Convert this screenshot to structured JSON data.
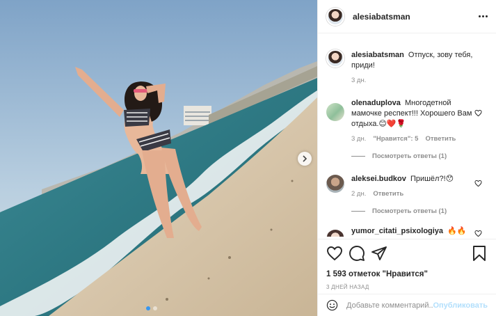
{
  "post": {
    "username": "alesiabatsman",
    "caption": "Отпуск, зову тебя, приди!",
    "caption_time": "3 дн.",
    "photo_icon": "beach-photo",
    "next_icon": "chevron-right-icon"
  },
  "comments": [
    {
      "username": "olenaduplova",
      "text": "Многодетной мамочке респект!!! Хорошего Вам отдыха.😊❤️🌹",
      "time": "3 дн.",
      "likes": "\"Нравится\": 5",
      "reply_label": "Ответить",
      "view_replies": "Посмотреть ответы (1)"
    },
    {
      "username": "aleksei.budkov",
      "text": "Пришёл?!😯",
      "time": "2 дн.",
      "reply_label": "Ответить",
      "view_replies": "Посмотреть ответы (1)"
    },
    {
      "username": "yumor_citati_psixologiya",
      "text": "🔥🔥🔥"
    }
  ],
  "actions": {
    "like_icon": "heart-icon",
    "comment_icon": "comment-icon",
    "share_icon": "share-icon",
    "save_icon": "bookmark-icon"
  },
  "stats": {
    "likes_text": "1 593 отметок \"Нравится\"",
    "date": "3 дней назад"
  },
  "add_comment": {
    "placeholder": "Добавьте комментарий...",
    "publish_label": "Опубликовать"
  },
  "colors": {
    "accent": "#3897f0",
    "publish_disabled": "#b2dffc",
    "muted_text": "#8e8e8e",
    "border": "#efefef"
  }
}
